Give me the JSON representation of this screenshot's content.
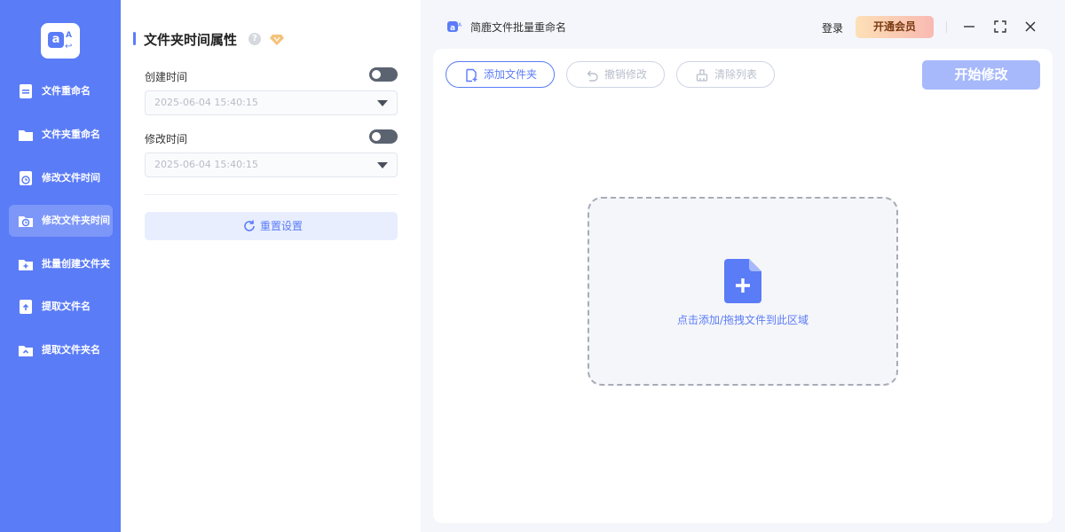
{
  "sidebar": {
    "items": [
      {
        "label": "文件重命名",
        "icon": "file-rename-icon"
      },
      {
        "label": "文件夹重命名",
        "icon": "folder-icon"
      },
      {
        "label": "修改文件时间",
        "icon": "file-clock-icon"
      },
      {
        "label": "修改文件夹时间",
        "icon": "folder-clock-icon",
        "active": true
      },
      {
        "label": "批量创建文件夹",
        "icon": "folder-plus-icon"
      },
      {
        "label": "提取文件名",
        "icon": "file-upload-icon"
      },
      {
        "label": "提取文件夹名",
        "icon": "folder-upload-icon"
      }
    ],
    "accent": "#5b7cf7"
  },
  "panel": {
    "title": "文件夹时间属性",
    "help": "?",
    "created": {
      "label": "创建时间",
      "value": "2025-06-04 15:40:15",
      "enabled": false
    },
    "modified": {
      "label": "修改时间",
      "value": "2025-06-04 15:40:15",
      "enabled": false
    },
    "reset_label": "重置设置"
  },
  "header": {
    "app_title": "简鹿文件批量重命名",
    "login_label": "登录",
    "vip_label": "开通会员"
  },
  "toolbar": {
    "add_folder_label": "添加文件夹",
    "undo_label": "撤销修改",
    "clear_label": "清除列表",
    "start_label": "开始修改"
  },
  "dropzone": {
    "text": "点击添加/拖拽文件到此区域"
  }
}
